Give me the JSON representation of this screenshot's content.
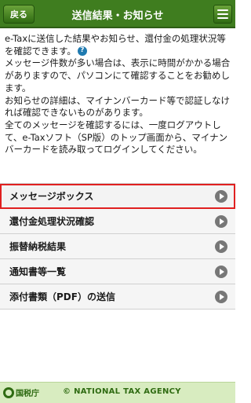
{
  "header": {
    "back_label": "戻る",
    "title": "送信結果・お知らせ",
    "menu_icon": "hamburger-icon"
  },
  "intro": {
    "p1": "e-Taxに送信した結果やお知らせ、還付金の処理状況等を確認できます。",
    "p2": "メッセージ件数が多い場合は、表示に時間がかかる場合がありますので、パソコンにて確認することをお勧めします。",
    "p3": "お知らせの詳細は、マイナンバーカード等で認証しなければ確認できないものがあります。",
    "p4": "全てのメッセージを確認するには、一度ログアウトして、e-Taxソフト（SP版）のトップ画面から、マイナンバーカードを読み取ってログインしてください。",
    "help_icon": "?"
  },
  "menu": {
    "items": [
      {
        "label": "メッセージボックス"
      },
      {
        "label": "還付金処理状況確認"
      },
      {
        "label": "振替納税結果"
      },
      {
        "label": "通知書等一覧"
      },
      {
        "label": "添付書類（PDF）の送信"
      }
    ]
  },
  "footer": {
    "logo_text": "国税庁",
    "copyright": "© NATIONAL TAX AGENCY"
  },
  "colors": {
    "header_green": "#3f7d1f",
    "footer_green": "#d8ecc0",
    "highlight_red": "#e02020"
  }
}
